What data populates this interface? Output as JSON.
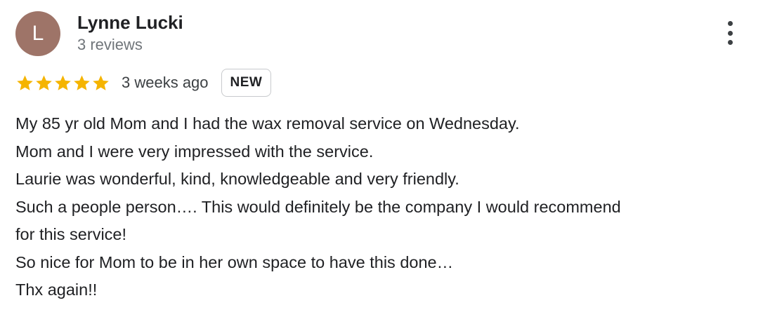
{
  "reviewer": {
    "avatar_letter": "L",
    "avatar_color": "#9e7468",
    "name": "Lynne Lucki",
    "review_count": "3 reviews"
  },
  "more_menu_icon": "more-vert-icon",
  "rating": {
    "stars": 5,
    "max_stars": 5,
    "star_color": "#f5b400",
    "date": "3 weeks ago",
    "badge": "NEW"
  },
  "review": {
    "lines": [
      "My 85 yr old Mom and I had the wax removal service on Wednesday.",
      "Mom and I were very impressed with the service.",
      "Laurie was wonderful, kind, knowledgeable and very friendly.",
      "Such a people person…. This would definitely be the company I would recommend",
      "for this service!",
      "So nice for Mom to be in her own space to have this done…",
      "Thx again!!"
    ]
  }
}
